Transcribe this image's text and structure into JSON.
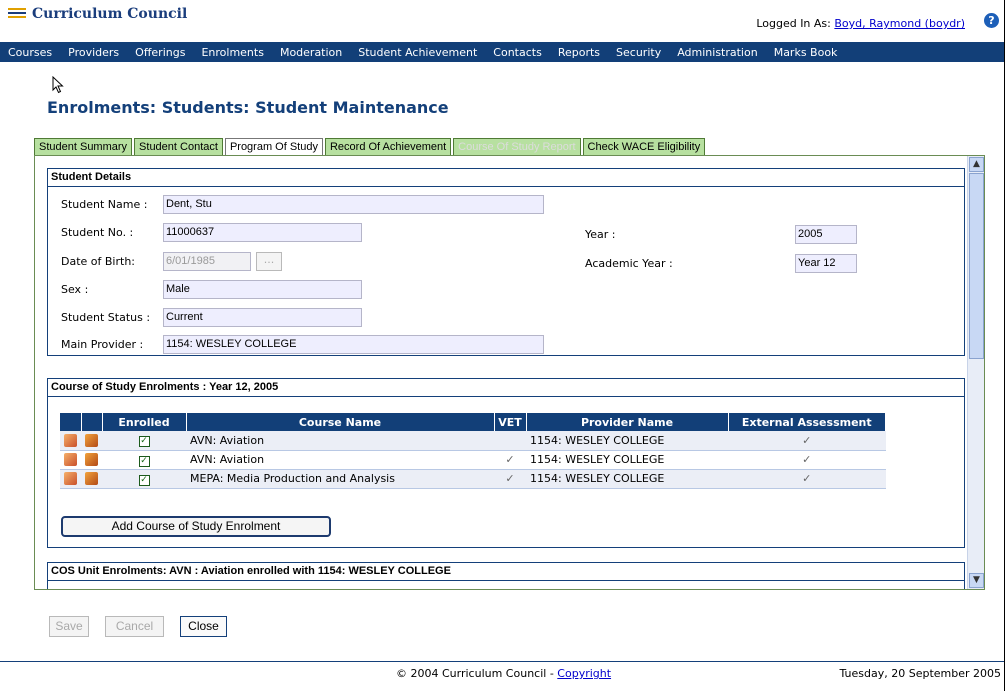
{
  "header": {
    "logo_text": "Curriculum Council",
    "logged_in_label": "Logged In As:",
    "logged_in_user": "Boyd, Raymond (boydr)",
    "help_glyph": "?"
  },
  "menu": [
    "Courses",
    "Providers",
    "Offerings",
    "Enrolments",
    "Moderation",
    "Student Achievement",
    "Contacts",
    "Reports",
    "Security",
    "Administration",
    "Marks Book"
  ],
  "page_title": "Enrolments: Students: Student Maintenance",
  "tabs": [
    {
      "label": "Student Summary"
    },
    {
      "label": "Student Contact"
    },
    {
      "label": "Program Of Study"
    },
    {
      "label": "Record Of Achievement"
    },
    {
      "label": "Course Of Study Report"
    },
    {
      "label": "Check WACE Eligibility"
    }
  ],
  "student_details": {
    "heading": "Student Details",
    "name_label": "Student Name :",
    "name_value": "Dent, Stu",
    "no_label": "Student No. :",
    "no_value": "11000637",
    "dob_label": "Date of Birth:",
    "dob_value": "6/01/1985",
    "dob_button": "...",
    "sex_label": "Sex :",
    "sex_value": "Male",
    "status_label": "Student Status :",
    "status_value": "Current",
    "provider_label": "Main Provider :",
    "provider_value": "1154: WESLEY COLLEGE",
    "year_label": "Year :",
    "year_value": "2005",
    "acad_label": "Academic Year :",
    "acad_value": "Year 12"
  },
  "cos": {
    "heading": "Course of Study Enrolments : Year 12, 2005",
    "columns": {
      "enrolled": "Enrolled",
      "course": "Course Name",
      "vet": "VET",
      "provider": "Provider Name",
      "external": "External Assessment"
    },
    "rows": [
      {
        "course": "AVN: Aviation",
        "vet": "",
        "provider": "1154: WESLEY COLLEGE",
        "external": "✓"
      },
      {
        "course": "AVN: Aviation",
        "vet": "✓",
        "provider": "1154: WESLEY COLLEGE",
        "external": "✓"
      },
      {
        "course": "MEPA: Media Production and Analysis",
        "vet": "✓",
        "provider": "1154: WESLEY COLLEGE",
        "external": "✓"
      }
    ],
    "add_button": "Add Course of Study Enrolment"
  },
  "unit": {
    "heading": "COS Unit Enrolments: AVN : Aviation enrolled with 1154: WESLEY COLLEGE"
  },
  "buttons": {
    "save": "Save",
    "cancel": "Cancel",
    "close": "Close"
  },
  "footer": {
    "copyright": "© 2004 Curriculum Council - ",
    "link": "Copyright",
    "date": "Tuesday, 20 September 2005"
  },
  "colors": {
    "navy": "#123f78",
    "tab_green": "#b7e0a0",
    "field_bg": "#eeeefe",
    "brand_gold": "#e0a000"
  },
  "icons": {
    "edit": "edit-icon",
    "delete": "delete-icon",
    "cursor": "arrow-cursor-icon",
    "help": "help-icon"
  }
}
